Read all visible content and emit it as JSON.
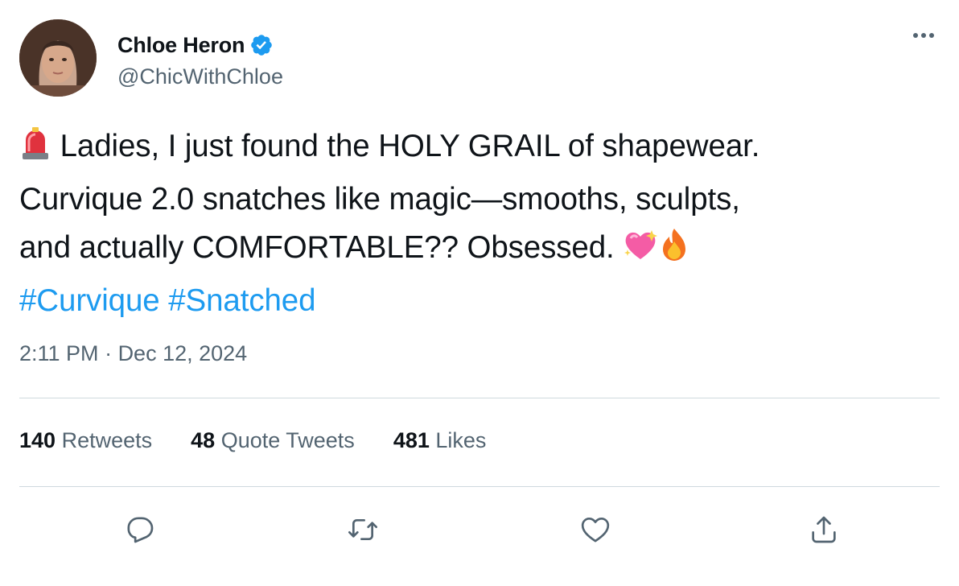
{
  "author": {
    "display_name": "Chloe Heron",
    "handle": "@ChicWithChloe",
    "verified": true
  },
  "tweet": {
    "text_line1": "Ladies, I just found the HOLY GRAIL of shapewear.",
    "text_line2": "Curvique 2.0 snatches like magic—smooths, sculpts,",
    "text_line3": "and actually COMFORTABLE?? Obsessed.",
    "hashtags": [
      "#Curvique",
      "#Snatched"
    ],
    "time": "2:11 PM",
    "separator": " · ",
    "date": "Dec 12, 2024"
  },
  "stats": {
    "retweets": {
      "count": "140",
      "label": "Retweets"
    },
    "quotes": {
      "count": "48",
      "label": "Quote Tweets"
    },
    "likes": {
      "count": "481",
      "label": "Likes"
    }
  },
  "icons": {
    "siren": "rotating-light-emoji",
    "heart_sparkle": "sparkling-heart-emoji",
    "fire": "fire-emoji",
    "verified": "verified-badge-icon"
  },
  "colors": {
    "accent": "#1d9bf0",
    "secondary_text": "#536471",
    "divider": "#cfd9de"
  }
}
